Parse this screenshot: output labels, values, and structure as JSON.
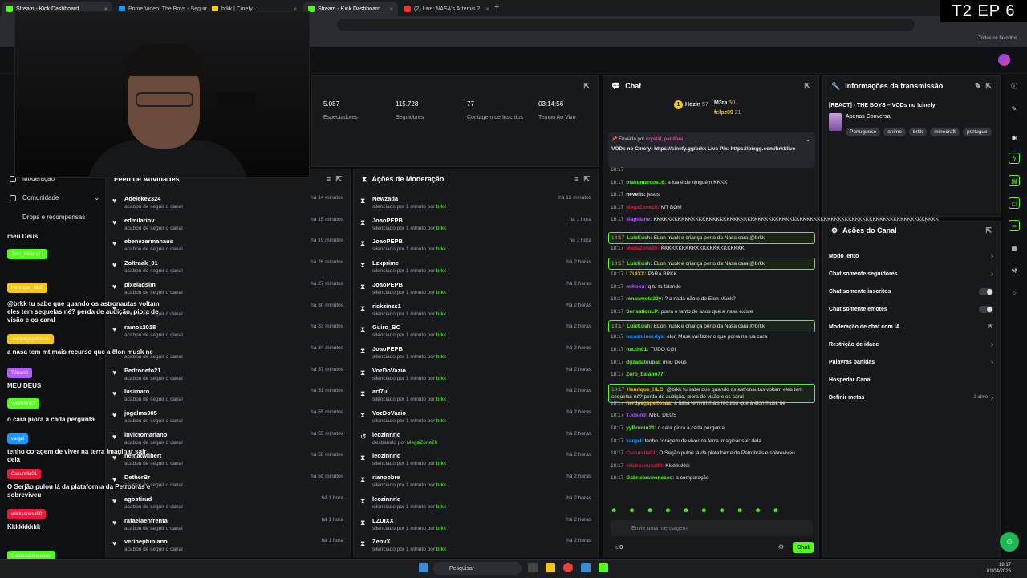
{
  "browser": {
    "tabs": [
      {
        "label": "Stream - Kick Dashboard",
        "color": "#53fc18"
      },
      {
        "label": "Prime Video: The Boys - Seguir",
        "color": "#1a98ff"
      },
      {
        "label": "brkk | Cinefy",
        "color": "#f5c518"
      },
      {
        "label": "Stream - Kick Dashboard",
        "color": "#53fc18"
      },
      {
        "label": "(2) Live: NASA's Artemis 2",
        "color": "#ff2d2d"
      }
    ],
    "favorites_label": "Todos os favoritos"
  },
  "episode_badge": "T2 EP 6",
  "left_nav": {
    "moderation": "Moderação",
    "community": "Comunidade",
    "drops": "Drops e recompensas"
  },
  "stream_overlay_chat": [
    {
      "name": "",
      "color": "#53fc18",
      "msg": "meu Deus"
    },
    {
      "name": "Zoro_baiano77",
      "color": "#53fc18",
      "msg": ""
    },
    {
      "name": "Henrique_HLC",
      "color": "#f5c518",
      "msg": "@brkk tu sabe que quando os astronautas voltam eles tem sequelas né? perda de audição, piora de visão e os caral"
    },
    {
      "name": "nerdpegapeitosaa",
      "color": "#f5c518",
      "msg": "a nasa tem mt mais recurso que a elon musk ne"
    },
    {
      "name": "TJosin0",
      "color": "#b05cff",
      "msg": "MEU DEUS"
    },
    {
      "name": "yyBrunin21",
      "color": "#53fc18",
      "msg": "o cara piora a cada pergunta"
    },
    {
      "name": "vargel",
      "color": "#1a98ff",
      "msg": "tenho coragem de viver na terra imaginar sair dela"
    },
    {
      "name": "Cucurella01",
      "color": "#e8193c",
      "msg": "O Serjão pulou lá da plataforma da Petrobrás e sobreviveu"
    },
    {
      "name": "erickssousa90",
      "color": "#e8193c",
      "msg": "Kkkkkkkkk"
    },
    {
      "name": "Gabrielosmeneses",
      "color": "#53fc18",
      "msg": "a comparação"
    }
  ],
  "stats": [
    {
      "value": "5.087",
      "label": "Espectadores"
    },
    {
      "value": "115.728",
      "label": "Seguidores"
    },
    {
      "value": "77",
      "label": "Contagem de Inscritos"
    },
    {
      "value": "03:14:56",
      "label": "Tempo Ao Vivo"
    }
  ],
  "feed": {
    "title": "Feed de Atividades",
    "rows": [
      {
        "name": "Adeleke2324",
        "sub": "acabou de seguir o canal",
        "time": "há 14 minutos"
      },
      {
        "name": "edmilariov",
        "sub": "acabou de seguir o canal",
        "time": "há 15 minutos"
      },
      {
        "name": "ebenezermanaus",
        "sub": "acabou de seguir o canal",
        "time": "há 19 minutos"
      },
      {
        "name": "Zoltraak_01",
        "sub": "acabou de seguir o canal",
        "time": "há 26 minutos"
      },
      {
        "name": "pixeladsim",
        "sub": "acabou de seguir o canal",
        "time": "há 27 minutos"
      },
      {
        "name": "",
        "sub": "acabou de seguir o canal",
        "time": "há 30 minutos"
      },
      {
        "name": "ramos2018",
        "sub": "acabou de seguir o canal",
        "time": "há 33 minutos"
      },
      {
        "name": "",
        "sub": "acabou de seguir o canal",
        "time": "há 34 minutos"
      },
      {
        "name": "Pedroneto21",
        "sub": "acabou de seguir o canal",
        "time": "há 37 minutos"
      },
      {
        "name": "lusimaro",
        "sub": "acabou de seguir o canal",
        "time": "há 51 minutos"
      },
      {
        "name": "jogalma005",
        "sub": "acabou de seguir o canal",
        "time": "há 55 minutos"
      },
      {
        "name": "invictomariano",
        "sub": "acabou de seguir o canal",
        "time": "há 55 minutos"
      },
      {
        "name": "hematwilbert",
        "sub": "acabou de seguir o canal",
        "time": "há 58 minutos"
      },
      {
        "name": "DetherBr",
        "sub": "acabou de seguir o canal",
        "time": "há 59 minutos"
      },
      {
        "name": "agostirud",
        "sub": "acabou de seguir o canal",
        "time": "há 1 hora"
      },
      {
        "name": "rafaelaenfrenta",
        "sub": "acabou de seguir o canal",
        "time": "há 1 hora"
      },
      {
        "name": "verineptuniano",
        "sub": "acabou de seguir o canal",
        "time": "há 1 hora"
      }
    ]
  },
  "moderation": {
    "title": "Ações de Moderação",
    "rows": [
      {
        "name": "Newzada",
        "pre": "silenciado por 1 minuto por",
        "by": "brkk",
        "time": "há 16 minutos"
      },
      {
        "name": "JoaoPEPB",
        "pre": "silenciado por 1 minuto por",
        "by": "brkk",
        "time": "há 1 hora"
      },
      {
        "name": "JoaoPEPB",
        "pre": "silenciado por 1 minuto por",
        "by": "brkk",
        "time": "há 1 hora"
      },
      {
        "name": "Lzxprime",
        "pre": "silenciado por 1 minuto por",
        "by": "brkk",
        "time": "há 2 horas"
      },
      {
        "name": "JoaoPEPB",
        "pre": "silenciado por 1 minuto por",
        "by": "brkk",
        "time": "há 2 horas"
      },
      {
        "name": "rickzinzs1",
        "pre": "silenciado por 1 minuto por",
        "by": "brkk",
        "time": "há 2 horas"
      },
      {
        "name": "Guiro_BC",
        "pre": "silenciado por 1 minuto por",
        "by": "brkk",
        "time": "há 2 horas"
      },
      {
        "name": "JoaoPEPB",
        "pre": "silenciado por 1 minuto por",
        "by": "brkk",
        "time": "há 2 horas"
      },
      {
        "name": "VozDoVazio",
        "pre": "silenciado por 1 minuto por",
        "by": "brkk",
        "time": "há 2 horas"
      },
      {
        "name": "art7ui",
        "pre": "silenciado por 1 minuto por",
        "by": "brkk",
        "time": "há 2 horas"
      },
      {
        "name": "VozDoVazio",
        "pre": "silenciado por 1 minuto por",
        "by": "brkk",
        "time": "há 2 horas"
      },
      {
        "name": "leozinnrlq",
        "pre": "desbanido por",
        "by": "MegaZone26",
        "time": "há 2 horas"
      },
      {
        "name": "leozinnrlq",
        "pre": "silenciado por 1 minuto por",
        "by": "brkk",
        "time": "há 2 horas"
      },
      {
        "name": "rianpobre",
        "pre": "silenciado por 1 minuto por",
        "by": "brkk",
        "time": "há 2 horas"
      },
      {
        "name": "leozinnrlq",
        "pre": "silenciado por 1 minuto por",
        "by": "brkk",
        "time": "há 2 horas"
      },
      {
        "name": "LZUIXX",
        "pre": "silenciado por 1 minuto por",
        "by": "brkk",
        "time": "há 2 horas"
      },
      {
        "name": "ZenvX",
        "pre": "silenciado por 1 minuto por",
        "by": "brkk",
        "time": "há 2 horas"
      }
    ]
  },
  "chat": {
    "title": "Chat",
    "leaders": [
      {
        "name": "Hdzin",
        "count": "57"
      },
      {
        "name": "M3ra",
        "count": "50"
      },
      {
        "name": "felpz09",
        "count": "21"
      }
    ],
    "pinned_by_label": "Enviado por",
    "pinned_user": "crystal_pandora",
    "pinned_text": "VODs no Cinefy: https://cinefy.gg/brkk Live Pix: https://pixgg.com/brkklive",
    "messages": [
      {
        "t": "18:17",
        "u": "",
        "c": "#e8193c",
        "m": "",
        "hl": false
      },
      {
        "t": "18:17",
        "u": "otakumarcos16:",
        "c": "#53fc18",
        "m": "a lua é de ninguém KKKK",
        "hl": false
      },
      {
        "t": "18:17",
        "u": "nevetis:",
        "c": "#e4e4e4",
        "m": "jesus",
        "hl": false
      },
      {
        "t": "18:17",
        "u": "MegaZone26:",
        "c": "#e8193c",
        "m": "MT BOM",
        "hl": false
      },
      {
        "t": "18:17",
        "u": "lilapidane:",
        "c": "#b05cff",
        "m": "KKKKKKKKKKKKKKKKKKKKKKKKKKKKKKKKKKKKKKKKKKKKKKKKKKKKKKKKKKKKKKKKKKKKKKKKKKKKKKKKKK",
        "hl": false
      },
      {
        "t": "18:17",
        "u": "LuizKush:",
        "c": "#53fc18",
        "m": "ELon musk e criança perto da Nasa cara @brkk",
        "hl": true
      },
      {
        "t": "18:17",
        "u": "MegaZone26:",
        "c": "#e8193c",
        "m": "KKKKKKKKKKKKKKKKKKKKKKKK",
        "hl": false
      },
      {
        "t": "18:17",
        "u": "LuizKush:",
        "c": "#53fc18",
        "m": "ELon musk e criança perto da Nasa cara @brkk",
        "hl": true
      },
      {
        "t": "18:17",
        "u": "LZUIXX:",
        "c": "#f5c518",
        "m": "PARA BRKK",
        "hl": false
      },
      {
        "t": "18:17",
        "u": "mihoku:",
        "c": "#b05cff",
        "m": "q tu ta falando",
        "hl": false
      },
      {
        "t": "18:17",
        "u": "renanmota22y:",
        "c": "#53fc18",
        "m": "? a nada não e do Elon Musk?",
        "hl": false
      },
      {
        "t": "18:17",
        "u": "SensationLP:",
        "c": "#53fc18",
        "m": "porra o tanto de anos que a nasa existe",
        "hl": false
      },
      {
        "t": "18:17",
        "u": "LuizKush:",
        "c": "#53fc18",
        "m": "ELon musk e criança perto da Nasa cara @brkk",
        "hl": true
      },
      {
        "t": "18:17",
        "u": "lucasminecdys:",
        "c": "#1a98ff",
        "m": "elon Musk vai fazer o que porra na lua cara",
        "hl": false
      },
      {
        "t": "18:17",
        "u": "foxzin01:",
        "c": "#53fc18",
        "m": "TUDO CGI",
        "hl": false
      },
      {
        "t": "18:17",
        "u": "dgzadateupai:",
        "c": "#53fc18",
        "m": "meu Deus",
        "hl": false
      },
      {
        "t": "18:17",
        "u": "Zoro_baiano77:",
        "c": "#53fc18",
        "m": "",
        "hl": false
      },
      {
        "t": "18:17",
        "u": "Henrique_HLC:",
        "c": "#f5c518",
        "m": "@brkk tu sabe que quando os astronautas voltam eles tem sequelas né? perda de audição, piora de visão e os caral",
        "hl": true
      },
      {
        "t": "18:17",
        "u": "nerdpegapeitosaa:",
        "c": "#f5c518",
        "m": "a nasa tem mt mais recurso que a elon musk ne",
        "hl": false
      },
      {
        "t": "18:17",
        "u": "TJosin0:",
        "c": "#b05cff",
        "m": "MEU DEUS",
        "hl": false
      },
      {
        "t": "18:17",
        "u": "yyBrunin21:",
        "c": "#53fc18",
        "m": "o cara piora a cada pergunta",
        "hl": false
      },
      {
        "t": "18:17",
        "u": "vargel:",
        "c": "#1a98ff",
        "m": "tenho coragem de viver na terra imaginar sair dela",
        "hl": false
      },
      {
        "t": "18:17",
        "u": "Cucurella01:",
        "c": "#e8193c",
        "m": "O Serjão pulou lá da plataforma da Petrobrás e sobreviveu",
        "hl": false
      },
      {
        "t": "18:17",
        "u": "erickssousa90:",
        "c": "#e8193c",
        "m": "Kkkkkkkkk",
        "hl": false
      },
      {
        "t": "18:17",
        "u": "Gabrielosmeneses:",
        "c": "#53fc18",
        "m": "a comparação",
        "hl": false
      }
    ],
    "input_placeholder": "Envie uma mensagem",
    "viewer_count": "0",
    "send_label": "Chat"
  },
  "info": {
    "title": "Informações da transmissão",
    "stream_title": "[REACT] - THE BOYS – VODs no !cinefy",
    "category": "Apenas Conversa",
    "tags": [
      "Portuguese",
      "anime",
      "brkk",
      "minecraft",
      "portugue"
    ]
  },
  "canal": {
    "title": "Ações do Canal",
    "rows": [
      {
        "label": "Modo lento",
        "kind": "arrow"
      },
      {
        "label": "Chat somente seguidores",
        "kind": "arrow"
      },
      {
        "label": "Chat somente inscritos",
        "kind": "toggle"
      },
      {
        "label": "Chat somente emotes",
        "kind": "toggle"
      },
      {
        "label": "Moderação de chat com IA",
        "kind": "ext"
      },
      {
        "label": "Restrição de idade",
        "kind": "arrow"
      },
      {
        "label": "Palavras banidas",
        "kind": "arrow"
      },
      {
        "label": "Hospedar Canal",
        "kind": "none"
      },
      {
        "label": "Definir metas",
        "kind": "meta",
        "note": "2 ativo"
      }
    ]
  },
  "taskbar": {
    "search": "Pesquisar",
    "time": "18:17",
    "date": "01/04/2026"
  },
  "colors": {
    "kick_green": "#53fc18",
    "panel": "#18191d",
    "bg": "#0b0c0e"
  }
}
